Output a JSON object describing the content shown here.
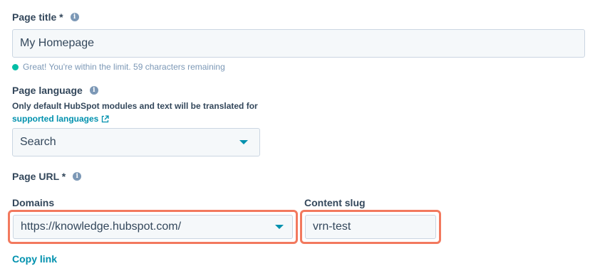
{
  "page_title": {
    "label": "Page title *",
    "value": "My Homepage",
    "hint": "Great! You're within the limit. 59 characters remaining"
  },
  "page_language": {
    "label": "Page language",
    "help_text": "Only default HubSpot modules and text will be translated for",
    "help_link": "supported languages",
    "select_value": "Search"
  },
  "page_url": {
    "label": "Page URL *",
    "domains_label": "Domains",
    "domain_value": "https://knowledge.hubspot.com/",
    "slug_label": "Content slug",
    "slug_value": "vrn-test",
    "copy_link": "Copy link"
  },
  "colors": {
    "accent": "#0091ae",
    "highlight": "#f2795e",
    "success": "#00bda5",
    "text": "#33475b"
  }
}
